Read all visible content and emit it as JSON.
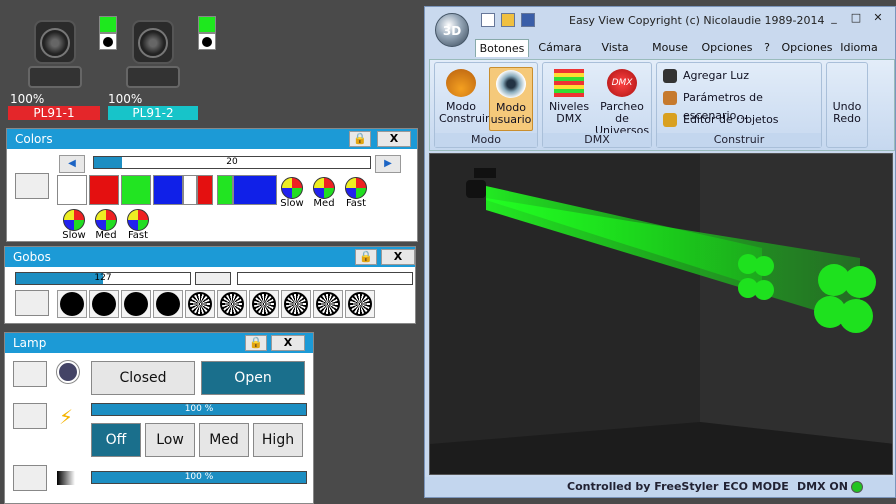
{
  "fixtures": [
    {
      "name": "PL91-1",
      "intensity": "100%",
      "label_color": "#e4262a"
    },
    {
      "name": "PL91-2",
      "intensity": "100%",
      "label_color": "#17c4c9"
    }
  ],
  "colors_panel": {
    "title": "Colors",
    "lock_icon": "lock-icon",
    "close_label": "X",
    "slider_value": "20",
    "slider_fraction": 0.1,
    "swatches": [
      "#ffffff",
      "#e41010",
      "#22e422",
      "#1020e8",
      "#ffffff",
      "#e41010",
      "#22e422",
      "#1020e8"
    ],
    "effects_row1": [
      "Slow",
      "Med",
      "Fast"
    ],
    "effects_row2": [
      "Slow",
      "Med",
      "Fast"
    ]
  },
  "gobos_panel": {
    "title": "Gobos",
    "close_label": "X",
    "slider_value": "127",
    "slider_fraction": 0.5
  },
  "lamp_panel": {
    "title": "Lamp",
    "close_label": "X",
    "closed_label": "Closed",
    "open_label": "Open",
    "dimmer_value": "100 %",
    "dimmer_fraction": 1.0,
    "levels": [
      "Off",
      "Low",
      "Med",
      "High"
    ],
    "second_value": "100 %",
    "second_fraction": 1.0
  },
  "app": {
    "orb_label": "3D",
    "title": "Easy View   Copyright (c) Nicolaudie 1989-2014",
    "window_buttons": [
      "_",
      "□",
      "✕"
    ],
    "tabs": [
      "Botones e",
      "Cámara",
      "Vista",
      "Mouse",
      "Opciones"
    ],
    "right_menu": [
      "?",
      "Opciones",
      "Idioma"
    ],
    "groups": {
      "modo": {
        "label": "Modo",
        "buttons": [
          {
            "label": "Modo Construir",
            "icon": "hardhat-icon"
          },
          {
            "label": "Modo usuario",
            "icon": "eye-icon"
          }
        ]
      },
      "dmx": {
        "label": "DMX",
        "buttons": [
          {
            "label": "Niveles DMX",
            "icon": "levels-icon"
          },
          {
            "label": "Parcheo de Universos",
            "icon": "dmx-icon"
          }
        ]
      },
      "construir": {
        "label": "Construir",
        "items": [
          "Agregar Luz",
          "Parámetros de escenario…",
          "Editor de Objetos simples"
        ]
      },
      "redo": {
        "label": "Undo Redo"
      }
    },
    "status": {
      "controlled": "Controlled by FreeStyler",
      "eco": "ECO MODE",
      "dmx": "DMX ON",
      "dmx_color": "#22c422"
    }
  }
}
